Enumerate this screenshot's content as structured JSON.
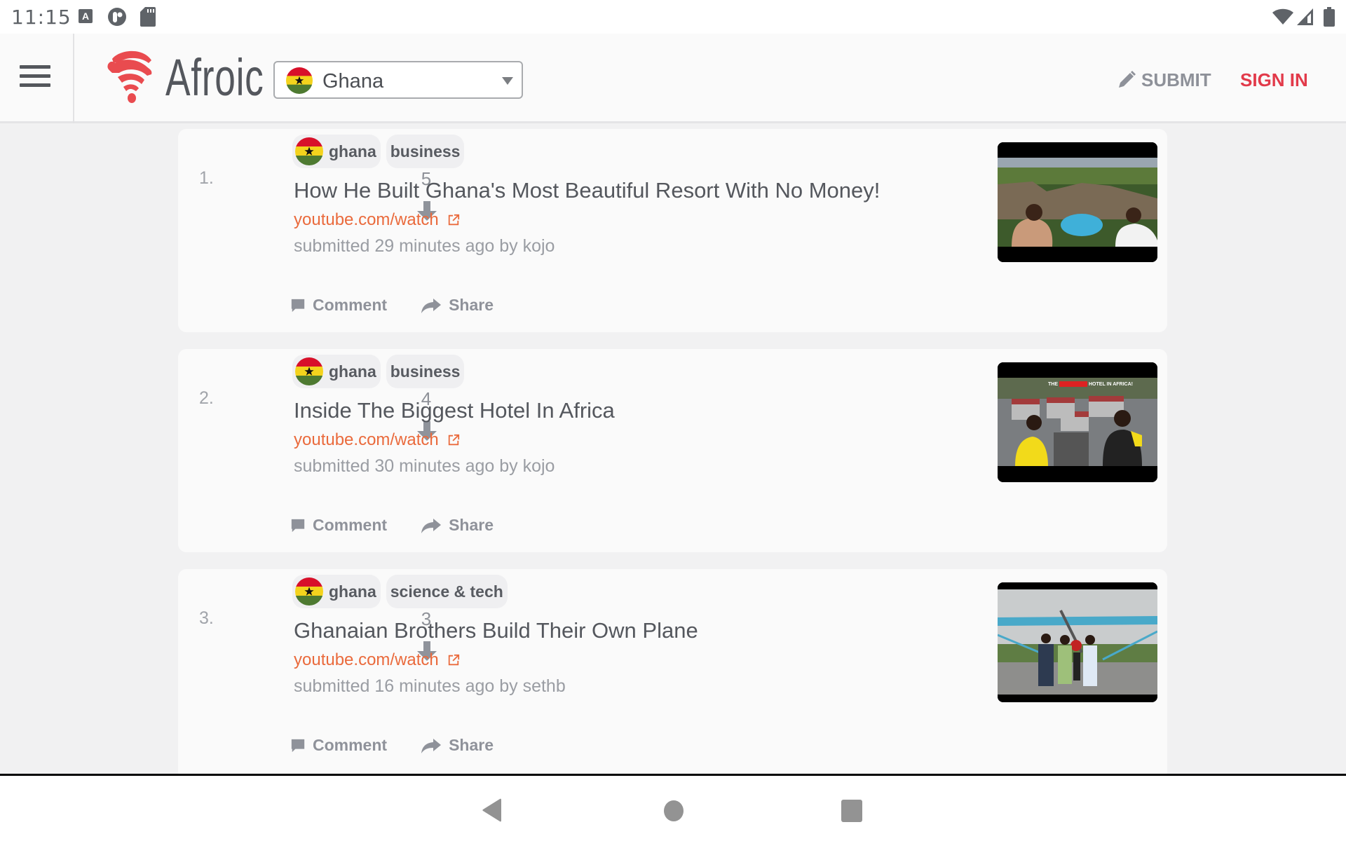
{
  "status_bar": {
    "time": "11:15",
    "left_icons": [
      "text-input-icon",
      "app-notification-icon",
      "sd-card-icon"
    ],
    "right_icons": [
      "wifi-icon",
      "cellular-signal-icon",
      "battery-icon"
    ]
  },
  "header": {
    "menu_icon": "hamburger-menu-icon",
    "brand": "Afroic",
    "country_select": {
      "selected": "Ghana",
      "flag": "ghana-flag"
    },
    "submit_label": "SUBMIT",
    "signin_label": "SIGN IN"
  },
  "colors": {
    "accent_red": "#e23a4a",
    "link_orange": "#ea6a3c",
    "muted_gray": "#8e9199",
    "ghana_red": "#d8102a",
    "ghana_yellow": "#f4d31d",
    "ghana_green": "#4e7a31"
  },
  "posts": [
    {
      "rank": "1.",
      "score": "5",
      "tags": [
        "ghana",
        "business"
      ],
      "title": "How He Built Ghana's Most Beautiful Resort With No Money!",
      "link": "youtube.com/watch",
      "meta": "submitted 29 minutes ago by kojo",
      "comment_label": "Comment",
      "share_label": "Share",
      "thumbnail": "resort-video-thumbnail"
    },
    {
      "rank": "2.",
      "score": "4",
      "tags": [
        "ghana",
        "business"
      ],
      "title": "Inside The Biggest Hotel In Africa",
      "link": "youtube.com/watch",
      "meta": "submitted 30 minutes ago by kojo",
      "comment_label": "Comment",
      "share_label": "Share",
      "thumbnail": "hotel-video-thumbnail",
      "thumbnail_caption": "THE BIGGEST HOTEL IN AFRICA"
    },
    {
      "rank": "3.",
      "score": "3",
      "tags": [
        "ghana",
        "science & tech"
      ],
      "title": "Ghanaian Brothers Build Their Own Plane",
      "link": "youtube.com/watch",
      "meta": "submitted 16 minutes ago by sethb",
      "comment_label": "Comment",
      "share_label": "Share",
      "thumbnail": "plane-video-thumbnail"
    }
  ],
  "nav_bar": {
    "buttons": [
      "back-button",
      "home-button",
      "recents-button"
    ]
  }
}
